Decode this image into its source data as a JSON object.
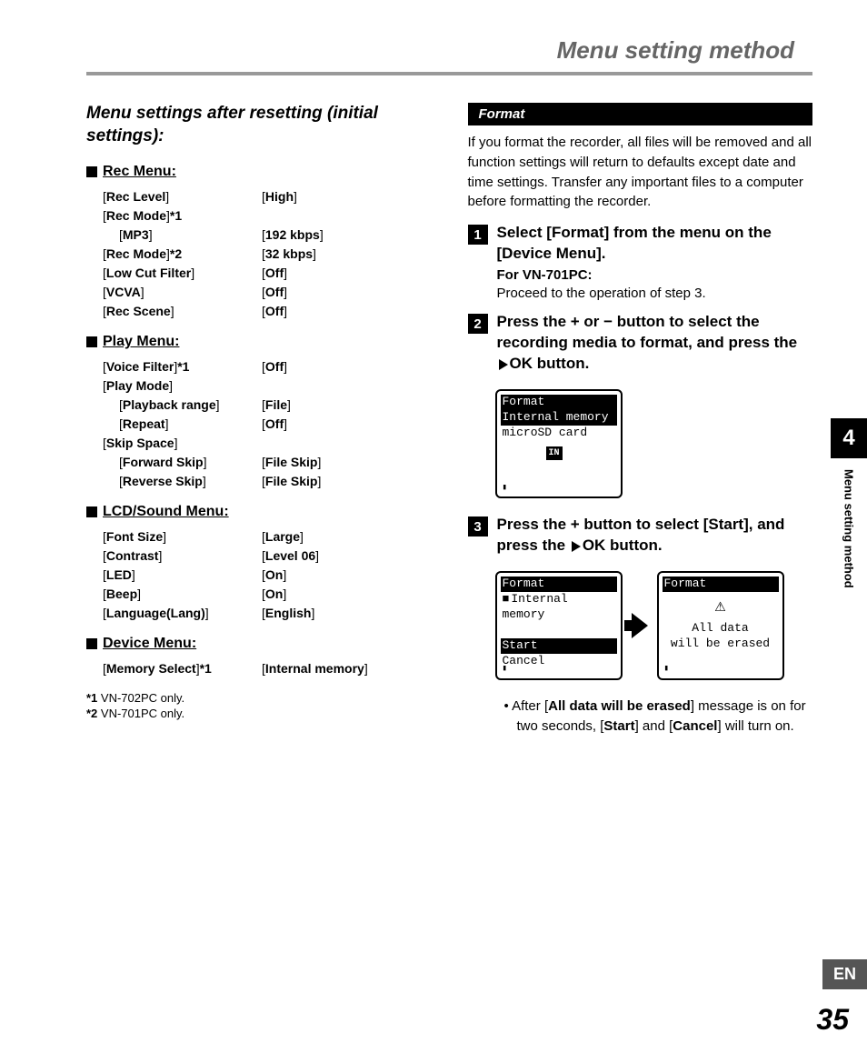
{
  "header": {
    "title": "Menu setting method"
  },
  "chapter": "4",
  "side_label": "Menu setting method",
  "lang": "EN",
  "page_number": "35",
  "left": {
    "heading": "Menu settings after resetting (initial settings):",
    "menus": [
      {
        "title": "Rec Menu:",
        "rows": [
          {
            "label": "Rec Level",
            "value": "High"
          },
          {
            "label": "Rec Mode",
            "suffix": "*1",
            "value": ""
          },
          {
            "sublabel": "MP3",
            "value": "192 kbps"
          },
          {
            "label": "Rec Mode",
            "suffix": "*2",
            "value": "32 kbps"
          },
          {
            "label": "Low Cut Filter",
            "value": "Off"
          },
          {
            "label": "VCVA",
            "value": "Off"
          },
          {
            "label": "Rec Scene",
            "value": "Off"
          }
        ]
      },
      {
        "title": "Play Menu:",
        "rows": [
          {
            "label": "Voice Filter",
            "suffix": "*1",
            "value": "Off"
          },
          {
            "label": "Play Mode",
            "value": ""
          },
          {
            "sublabel": "Playback range",
            "value": "File"
          },
          {
            "sublabel": "Repeat",
            "value": "Off"
          },
          {
            "label": "Skip Space",
            "value": ""
          },
          {
            "sublabel": "Forward Skip",
            "value": "File Skip"
          },
          {
            "sublabel": "Reverse Skip",
            "value": "File Skip"
          }
        ]
      },
      {
        "title": "LCD/Sound Menu:",
        "rows": [
          {
            "label": "Font Size",
            "value": "Large"
          },
          {
            "label": "Contrast",
            "value": "Level 06"
          },
          {
            "label": "LED",
            "value": "On"
          },
          {
            "label": "Beep",
            "value": "On"
          },
          {
            "label": "Language(Lang)",
            "value": "English"
          }
        ]
      },
      {
        "title": "Device Menu:",
        "rows": [
          {
            "label": "Memory Select",
            "suffix": "*1",
            "value": "Internal memory"
          }
        ]
      }
    ],
    "footnotes": [
      {
        "mark": "*1",
        "text": "VN-702PC only."
      },
      {
        "mark": "*2",
        "text": "VN-701PC only."
      }
    ]
  },
  "right": {
    "bar": "Format",
    "intro": "If you format the recorder, all files will be removed and all function settings will return to defaults except date and time settings. Transfer any important files to a computer before formatting the recorder.",
    "steps": [
      {
        "num": "1",
        "text_parts": [
          "Select [",
          "Format",
          "] from the menu on the [",
          "Device Menu",
          "]."
        ],
        "sub_bold": "For VN-701PC:",
        "sub_text": "Proceed to the operation of step 3."
      },
      {
        "num": "2",
        "text_parts": [
          "Press the + or − button to select the recording media to format, and press the ",
          "OK",
          " button."
        ],
        "has_play_icon": true
      },
      {
        "num": "3",
        "text_parts": [
          "Press the + button to select [",
          "Start",
          "], and press the ",
          "OK",
          " button."
        ],
        "has_play_icon": true
      }
    ],
    "lcd1": {
      "title": "Format",
      "line1": "Internal memory",
      "line2": "microSD card",
      "icon": "IN"
    },
    "lcd2": {
      "title": "Format",
      "sel": "Internal memory",
      "opt1": "Start",
      "opt2": "Cancel"
    },
    "lcd3": {
      "title": "Format",
      "msg1": "All data",
      "msg2": "will be erased"
    },
    "note_parts": [
      "After [",
      "All data will be erased",
      "] message is on for two seconds, [",
      "Start",
      "] and [",
      "Cancel",
      "] will turn on."
    ]
  }
}
